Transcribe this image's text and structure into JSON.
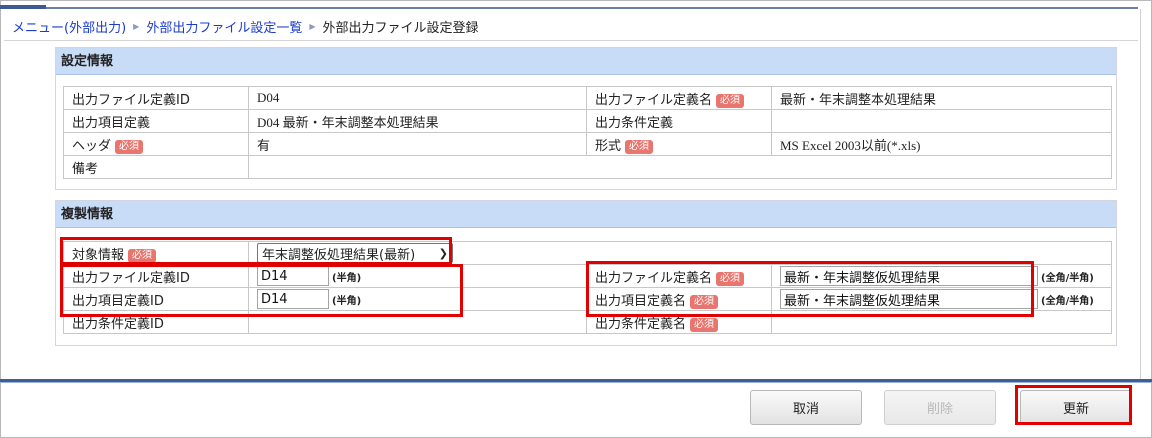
{
  "breadcrumb": {
    "items": [
      "メニュー(外部出力)",
      "外部出力ファイル設定一覧"
    ],
    "current": "外部出力ファイル設定登録"
  },
  "required_badge": "必須",
  "settings": {
    "title": "設定情報",
    "rows": [
      {
        "l1": "出力ファイル定義ID",
        "v1": "D04",
        "l2": "出力ファイル定義名",
        "v2": "最新・年末調整本処理結果"
      },
      {
        "l1": "出力項目定義",
        "v1": "D04 最新・年末調整本処理結果",
        "l2": "出力条件定義",
        "v2": ""
      },
      {
        "l1": "ヘッダ",
        "v1": "有",
        "l2": "形式",
        "v2": "MS Excel 2003以前(*.xls)"
      },
      {
        "l1": "備考",
        "v1": ""
      }
    ]
  },
  "copy": {
    "title": "複製情報",
    "target_label": "対象情報",
    "target_value": "年末調整仮処理結果(最新)",
    "file_def_id_label": "出力ファイル定義ID",
    "file_def_id_value": "D14",
    "item_def_id_label": "出力項目定義ID",
    "item_def_id_value": "D14",
    "cond_def_id_label": "出力条件定義ID",
    "file_def_name_label": "出力ファイル定義名",
    "file_def_name_value": "最新・年末調整仮処理結果",
    "item_def_name_label": "出力項目定義名",
    "item_def_name_value": "最新・年末調整仮処理結果",
    "cond_def_name_label": "出力条件定義名",
    "half_hint": "(半角)",
    "full_half_hint": "(全角/半角)"
  },
  "buttons": {
    "cancel": "取消",
    "delete": "削除",
    "update": "更新"
  },
  "colors": {
    "highlight": "#e00000",
    "header_bg": "#c8dcf8",
    "required": "#e8766f",
    "link": "#1a3ccc"
  }
}
